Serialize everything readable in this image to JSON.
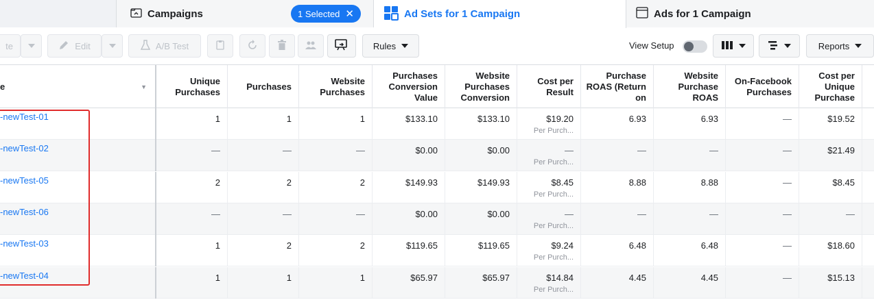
{
  "tabs": {
    "campaigns": {
      "label": "Campaigns",
      "selected_pill": "1 Selected"
    },
    "adsets": {
      "label": "Ad Sets for 1 Campaign"
    },
    "ads": {
      "label": "Ads for 1 Campaign"
    }
  },
  "toolbar": {
    "duplicate_partial": "te",
    "edit": "Edit",
    "ab_test": "A/B Test",
    "rules": "Rules",
    "view_setup": "View Setup",
    "reports": "Reports"
  },
  "table": {
    "name_header_partial": "e",
    "columns": [
      "Unique Purchases",
      "Purchases",
      "Website Purchases",
      "Purchases Conversion Value",
      "Website Purchases Conversion",
      "Cost per Result",
      "Purchase ROAS (Return on",
      "Website Purchase ROAS",
      "On-Facebook Purchases",
      "Cost per Unique Purchase"
    ],
    "result_sub": "Per Purch...",
    "rows": [
      {
        "name": "-newTest-01",
        "vals": [
          "1",
          "1",
          "1",
          "$133.10",
          "$133.10",
          "$19.20",
          "6.93",
          "6.93",
          "—",
          "$19.52"
        ]
      },
      {
        "name": "-newTest-02",
        "vals": [
          "—",
          "—",
          "—",
          "$0.00",
          "$0.00",
          "—",
          "—",
          "—",
          "—",
          "$21.49"
        ]
      },
      {
        "name": "-newTest-05",
        "vals": [
          "2",
          "2",
          "2",
          "$149.93",
          "$149.93",
          "$8.45",
          "8.88",
          "8.88",
          "—",
          "$8.45"
        ]
      },
      {
        "name": "-newTest-06",
        "vals": [
          "—",
          "—",
          "—",
          "$0.00",
          "$0.00",
          "—",
          "—",
          "—",
          "—",
          "—"
        ]
      },
      {
        "name": "-newTest-03",
        "vals": [
          "1",
          "2",
          "2",
          "$119.65",
          "$119.65",
          "$9.24",
          "6.48",
          "6.48",
          "—",
          "$18.60"
        ]
      },
      {
        "name": "-newTest-04",
        "vals": [
          "1",
          "1",
          "1",
          "$65.97",
          "$65.97",
          "$14.84",
          "4.45",
          "4.45",
          "—",
          "$15.13"
        ]
      }
    ]
  },
  "colors": {
    "accent": "#1877f2",
    "highlight": "#e02b2b"
  }
}
